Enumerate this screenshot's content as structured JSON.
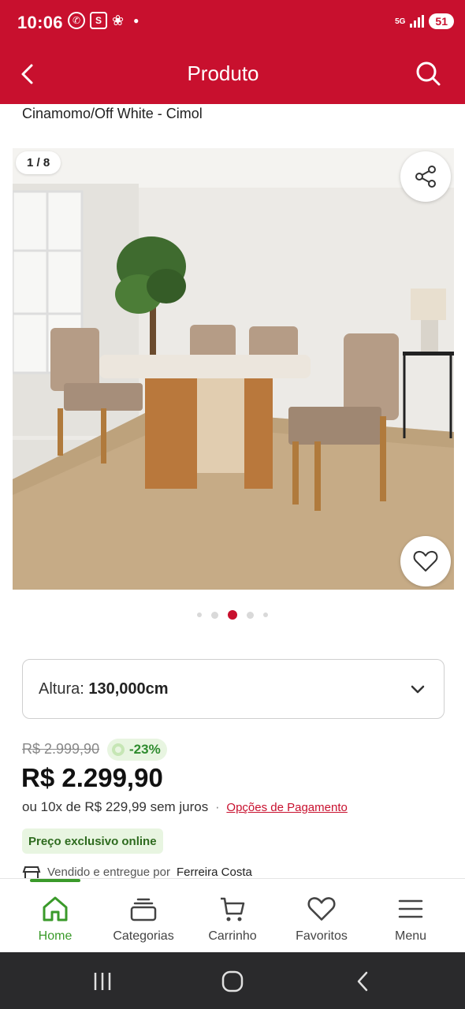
{
  "status_bar": {
    "time": "10:06",
    "notification_icons": [
      "whatsapp-icon",
      "s-app-icon",
      "bird-app-icon"
    ],
    "network": "5G",
    "battery": "51"
  },
  "app_bar": {
    "title": "Produto",
    "icons": [
      "back-arrow-icon",
      "search-icon"
    ]
  },
  "product": {
    "subtitle": "Cinamomo/Off White - Cimol",
    "gallery": {
      "counter": "1 / 8",
      "current_page": 3,
      "total_dots": 5
    },
    "variant": {
      "label": "Altura:",
      "value": "130,000cm"
    },
    "old_price": "R$ 2.999,90",
    "discount": "-23%",
    "price": "R$ 2.299,90",
    "installments": "ou 10x de R$ 229,99 sem juros",
    "installments_separator": "·",
    "payment_options_link": "Opções de Pagamento",
    "exclusive_badge": "Preço exclusivo online",
    "seller_text": "Vendido e entregue por",
    "seller_name": "Ferreira Costa"
  },
  "tab_bar": {
    "items": [
      {
        "label": "Home",
        "icon": "home-icon",
        "active": true
      },
      {
        "label": "Categorias",
        "icon": "categories-icon",
        "active": false
      },
      {
        "label": "Carrinho",
        "icon": "cart-icon",
        "active": false
      },
      {
        "label": "Favoritos",
        "icon": "heart-icon",
        "active": false
      },
      {
        "label": "Menu",
        "icon": "menu-icon",
        "active": false
      }
    ]
  },
  "colors": {
    "brand_red": "#c8102e",
    "active_green": "#3a9a2a",
    "discount_bg": "#e8f5e1"
  }
}
